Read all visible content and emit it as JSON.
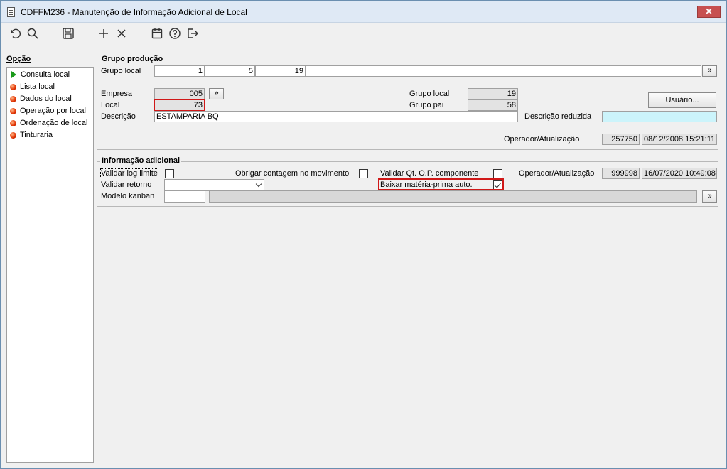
{
  "window": {
    "title": "CDFFM236 - Manutenção de Informação Adicional de Local",
    "close_label": "✕"
  },
  "toolbar": {
    "icons": [
      "undo-icon",
      "search-icon",
      "save-icon",
      "add-icon",
      "delete-icon",
      "calendar-icon",
      "help-icon",
      "exit-icon"
    ]
  },
  "sidebar": {
    "title": "Opção",
    "items": [
      {
        "label": "Consulta local",
        "icon": "green-arrow-icon"
      },
      {
        "label": "Lista local",
        "icon": "red-dot-icon"
      },
      {
        "label": "Dados do local",
        "icon": "red-dot-icon"
      },
      {
        "label": "Operação por local",
        "icon": "red-dot-icon"
      },
      {
        "label": "Ordenação de local",
        "icon": "red-dot-icon"
      },
      {
        "label": "Tinturaria",
        "icon": "red-dot-icon"
      }
    ]
  },
  "grupo_producao": {
    "title": "Grupo produção",
    "grupo_local_label": "Grupo local",
    "grupo_local_values": [
      "1",
      "5",
      "19"
    ],
    "nav_label": "»",
    "empresa_label": "Empresa",
    "empresa_value": "005",
    "empresa_btn": "»",
    "local_label": "Local",
    "local_value": "73",
    "descricao_label": "Descrição",
    "descricao_value": "ESTAMPARIA BQ",
    "grupo_local_right_label": "Grupo local",
    "grupo_local_right_value": "19",
    "grupo_pai_label": "Grupo pai",
    "grupo_pai_value": "58",
    "usuario_btn": "Usuário...",
    "descricao_reduzida_label": "Descrição reduzida",
    "descricao_reduzida_value": "",
    "operador_label": "Operador/Atualização",
    "operador_value": "257750",
    "atualizacao_value": "08/12/2008 15:21:11"
  },
  "info_adicional": {
    "title": "Informação adicional",
    "validar_log_label": "Validar log limite",
    "validar_log_checked": false,
    "obrigar_label": "Obrigar contagem no movimento",
    "obrigar_checked": false,
    "validar_qt_label": "Validar Qt. O.P. componente",
    "validar_qt_checked": false,
    "operador_label": "Operador/Atualização",
    "operador_value": "999998",
    "atualizacao_value": "16/07/2020 10:49:08",
    "validar_retorno_label": "Validar retorno",
    "validar_retorno_value": "",
    "baixar_label": "Baixar matéria-prima auto.",
    "baixar_checked": true,
    "modelo_kanban_label": "Modelo kanban",
    "modelo_kanban_value": "",
    "modelo_kanban_desc": "",
    "nav_label": "»"
  }
}
